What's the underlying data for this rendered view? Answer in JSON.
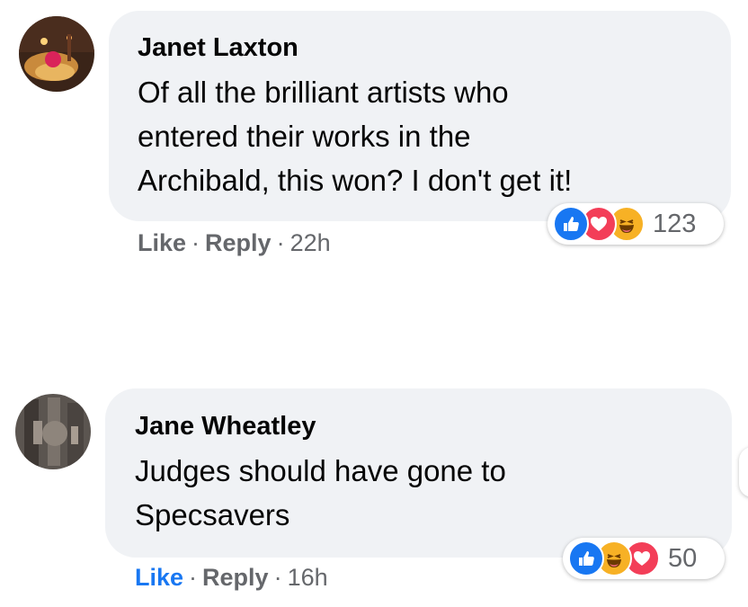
{
  "comments": [
    {
      "author": "Janet Laxton",
      "avatar": "avatar-janet",
      "text_lines": [
        "Of all the brilliant artists who",
        "entered their works in the",
        "Archibald, this won? I don't get it!"
      ],
      "actions": {
        "like": "Like",
        "reply": "Reply",
        "separator": "·",
        "time": "22h"
      },
      "reactions": {
        "icons": [
          "like",
          "love",
          "haha"
        ],
        "count": "123"
      }
    },
    {
      "author": "Jane Wheatley",
      "avatar": "avatar-jane",
      "text_lines": [
        "Judges should have gone to",
        "Specsavers"
      ],
      "actions": {
        "like": "Like",
        "reply": "Reply",
        "separator": "·",
        "time": "16h"
      },
      "reactions": {
        "icons": [
          "like",
          "haha",
          "love"
        ],
        "count": "50"
      }
    }
  ],
  "colors": {
    "bubble": "#f0f2f5",
    "text": "#050505",
    "secondary": "#65676b",
    "like_active": "#1877f2",
    "like_icon": "#1877f2",
    "love_icon": "#f33e58",
    "haha_icon": "#f7b125"
  }
}
